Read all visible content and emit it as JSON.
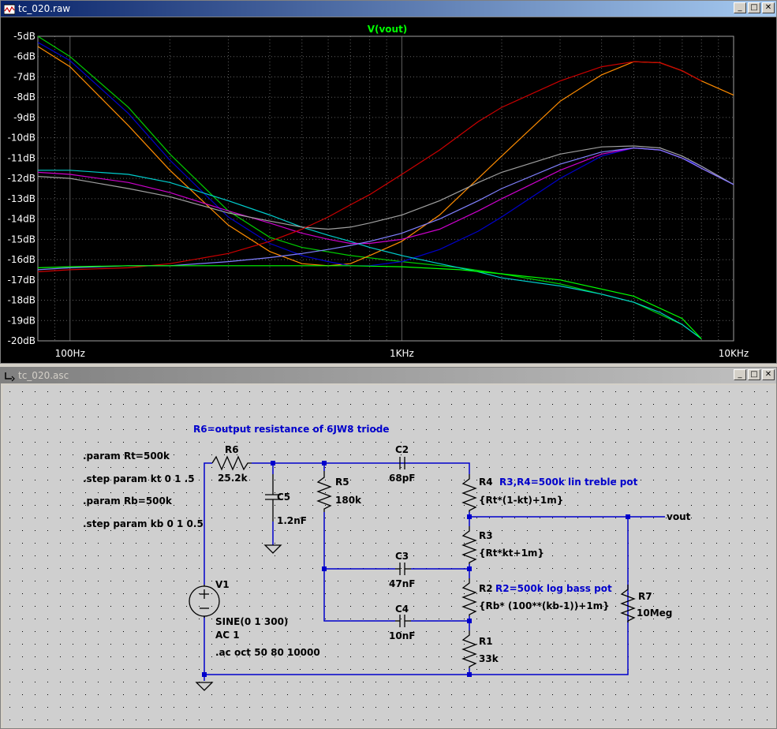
{
  "plot_window": {
    "title": "tc_020.raw",
    "trace_label": "V(vout)",
    "buttons": {
      "minimize": "_",
      "maximize": "□",
      "close": "✕"
    }
  },
  "chart_data": {
    "type": "line",
    "title": "V(vout)",
    "x_scale": "log",
    "xlim": [
      80,
      10000
    ],
    "ylim": [
      -20,
      -5
    ],
    "x_ticks": [
      {
        "v": 100,
        "label": "100Hz"
      },
      {
        "v": 1000,
        "label": "1KHz"
      },
      {
        "v": 10000,
        "label": "10KHz"
      }
    ],
    "y_ticks": [
      {
        "v": -5,
        "label": "-5dB"
      },
      {
        "v": -6,
        "label": "-6dB"
      },
      {
        "v": -7,
        "label": "-7dB"
      },
      {
        "v": -8,
        "label": "-8dB"
      },
      {
        "v": -9,
        "label": "-9dB"
      },
      {
        "v": -10,
        "label": "-10dB"
      },
      {
        "v": -11,
        "label": "-11dB"
      },
      {
        "v": -12,
        "label": "-12dB"
      },
      {
        "v": -13,
        "label": "-13dB"
      },
      {
        "v": -14,
        "label": "-14dB"
      },
      {
        "v": -15,
        "label": "-15dB"
      },
      {
        "v": -16,
        "label": "-16dB"
      },
      {
        "v": -17,
        "label": "-17dB"
      },
      {
        "v": -18,
        "label": "-18dB"
      },
      {
        "v": -19,
        "label": "-19dB"
      },
      {
        "v": -20,
        "label": "-20dB"
      }
    ],
    "grid": true,
    "background": "#000000",
    "grid_color": "#606060",
    "series": [
      {
        "color": "#00cc00",
        "x": [
          80,
          100,
          150,
          200,
          300,
          400,
          500,
          700,
          1000,
          1500,
          2000,
          3000,
          5000,
          7000,
          8000
        ],
        "y": [
          -5.0,
          -6.0,
          -8.5,
          -10.8,
          -13.6,
          -14.9,
          -15.4,
          -15.8,
          -16.1,
          -16.4,
          -16.7,
          -17.2,
          -18.1,
          -19.2,
          -19.9
        ]
      },
      {
        "color": "#ff8c00",
        "x": [
          80,
          100,
          150,
          200,
          300,
          400,
          500,
          600,
          700,
          800,
          1000,
          1300,
          1700,
          2000,
          3000,
          4000,
          5000,
          6000,
          7000,
          8000,
          10000
        ],
        "y": [
          -5.5,
          -6.5,
          -9.4,
          -11.6,
          -14.3,
          -15.6,
          -16.2,
          -16.3,
          -16.2,
          -15.8,
          -15.1,
          -13.8,
          -12.0,
          -10.9,
          -8.2,
          -6.9,
          -6.25,
          -6.3,
          -6.7,
          -7.2,
          -7.9
        ]
      },
      {
        "color": "#0000cc",
        "x": [
          80,
          100,
          150,
          200,
          300,
          400,
          500,
          600,
          700,
          800,
          1000,
          1300,
          1700,
          2000,
          3000,
          4000,
          5000,
          6000,
          7000,
          8000,
          10000
        ],
        "y": [
          -5.3,
          -6.2,
          -8.8,
          -11.1,
          -13.9,
          -15.2,
          -15.8,
          -16.1,
          -16.3,
          -16.3,
          -16.1,
          -15.5,
          -14.6,
          -13.9,
          -12.0,
          -10.9,
          -10.5,
          -10.6,
          -11.0,
          -11.4,
          -12.3
        ]
      },
      {
        "color": "#00cccc",
        "x": [
          80,
          100,
          150,
          200,
          300,
          400,
          500,
          600,
          700,
          800,
          1000,
          1300,
          1700,
          2000,
          3000,
          4000,
          5000,
          6000,
          7000,
          8000
        ],
        "y": [
          -11.6,
          -11.6,
          -11.8,
          -12.2,
          -13.1,
          -13.8,
          -14.4,
          -14.8,
          -15.1,
          -15.4,
          -15.8,
          -16.2,
          -16.6,
          -16.9,
          -17.3,
          -17.7,
          -18.1,
          -18.6,
          -19.2,
          -19.9
        ]
      },
      {
        "color": "#cc00cc",
        "x": [
          80,
          100,
          150,
          200,
          300,
          400,
          500,
          600,
          700,
          800,
          1000,
          1300,
          1700,
          2000,
          3000,
          4000,
          5000,
          6000,
          7000,
          8000,
          10000
        ],
        "y": [
          -11.7,
          -11.8,
          -12.2,
          -12.7,
          -13.6,
          -14.2,
          -14.7,
          -15.0,
          -15.2,
          -15.2,
          -15.0,
          -14.5,
          -13.6,
          -13.0,
          -11.6,
          -10.8,
          -10.5,
          -10.6,
          -11.0,
          -11.5,
          -12.3
        ]
      },
      {
        "color": "#a0a0a0",
        "x": [
          80,
          100,
          150,
          200,
          300,
          400,
          500,
          600,
          700,
          800,
          1000,
          1300,
          1700,
          2000,
          3000,
          4000,
          5000,
          6000,
          7000,
          8000,
          10000
        ],
        "y": [
          -11.9,
          -12.0,
          -12.5,
          -12.9,
          -13.7,
          -14.1,
          -14.4,
          -14.5,
          -14.4,
          -14.2,
          -13.8,
          -13.1,
          -12.2,
          -11.7,
          -10.8,
          -10.45,
          -10.4,
          -10.5,
          -10.9,
          -11.4,
          -12.3
        ]
      },
      {
        "color": "#cc0000",
        "x": [
          80,
          100,
          150,
          200,
          300,
          400,
          500,
          600,
          700,
          800,
          1000,
          1300,
          1700,
          2000,
          3000,
          4000,
          5000,
          6000,
          7000,
          8000
        ],
        "y": [
          -16.6,
          -16.5,
          -16.4,
          -16.2,
          -15.7,
          -15.1,
          -14.5,
          -13.9,
          -13.3,
          -12.8,
          -11.8,
          -10.6,
          -9.2,
          -8.5,
          -7.2,
          -6.5,
          -6.25,
          -6.3,
          -6.7,
          -7.2
        ]
      },
      {
        "color": "#8080ff",
        "x": [
          80,
          100,
          150,
          200,
          300,
          400,
          500,
          600,
          700,
          800,
          1000,
          1300,
          1700,
          2000,
          3000,
          4000,
          5000,
          6000,
          7000,
          8000,
          10000
        ],
        "y": [
          -16.5,
          -16.4,
          -16.3,
          -16.3,
          -16.1,
          -15.9,
          -15.7,
          -15.5,
          -15.3,
          -15.1,
          -14.7,
          -14.0,
          -13.1,
          -12.5,
          -11.3,
          -10.7,
          -10.5,
          -10.6,
          -11.0,
          -11.5,
          -12.3
        ]
      },
      {
        "color": "#00ff00",
        "x": [
          80,
          100,
          150,
          200,
          300,
          400,
          500,
          700,
          1000,
          1500,
          2000,
          3000,
          5000,
          7000,
          8000
        ],
        "y": [
          -16.4,
          -16.35,
          -16.3,
          -16.3,
          -16.3,
          -16.3,
          -16.3,
          -16.3,
          -16.35,
          -16.5,
          -16.7,
          -17.0,
          -17.8,
          -18.9,
          -19.9
        ]
      }
    ]
  },
  "schematic_window": {
    "title": "tc_020.asc",
    "buttons": {
      "minimize": "_",
      "maximize": "□",
      "close": "✕"
    },
    "comment": "R6=output resistance of 6JW8 triode",
    "directives": [
      ".param Rt=500k",
      ".step param kt 0 1 .5",
      ".param Rb=500k",
      ".step param kb 0 1 0.5"
    ],
    "components": {
      "R6": {
        "name": "R6",
        "value": "25.2k"
      },
      "C5": {
        "name": "C5",
        "value": "1.2nF"
      },
      "R5": {
        "name": "R5",
        "value": "180k"
      },
      "C2": {
        "name": "C2",
        "value": "68pF"
      },
      "R4": {
        "name": "R4",
        "value": "{Rt*(1-kt)+1m}"
      },
      "R3": {
        "name": "R3",
        "value": "{Rt*kt+1m}"
      },
      "C3": {
        "name": "C3",
        "value": "47nF"
      },
      "R2": {
        "name": "R2",
        "value": "{Rb* (100**(kb-1))+1m}"
      },
      "C4": {
        "name": "C4",
        "value": "10nF"
      },
      "R1": {
        "name": "R1",
        "value": "33k"
      },
      "R7": {
        "name": "R7",
        "value": "10Meg"
      },
      "V1": {
        "name": "V1",
        "value1": "SINE(0 1 300)",
        "value2": "AC 1"
      }
    },
    "ac_directive": ".ac oct 50 80 10000",
    "note_treble": "R3,R4=500k lin treble pot",
    "note_bass": "R2=500k log bass pot",
    "net_label": "vout",
    "colors": {
      "wire": "#0000cc",
      "component": "#000000",
      "comment": "#0000cc"
    }
  }
}
